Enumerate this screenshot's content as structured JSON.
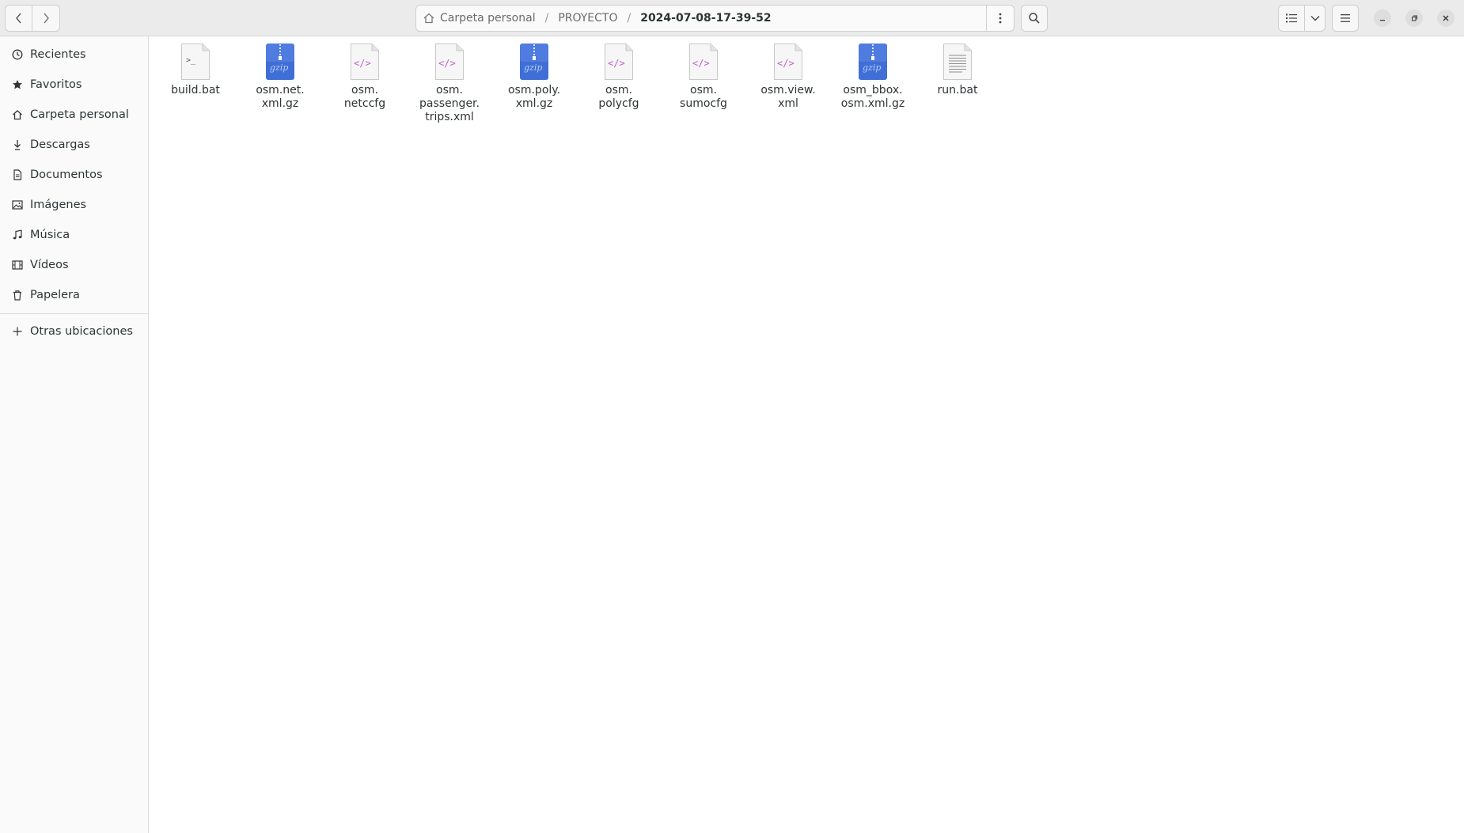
{
  "path": {
    "crumbs": [
      "Carpeta personal",
      "PROYECTO",
      "2024-07-08-17-39-52"
    ]
  },
  "sidebar": {
    "items": [
      {
        "label": "Recientes",
        "icon": "clock-icon"
      },
      {
        "label": "Favoritos",
        "icon": "star-icon"
      },
      {
        "label": "Carpeta personal",
        "icon": "home-icon"
      },
      {
        "label": "Descargas",
        "icon": "download-icon"
      },
      {
        "label": "Documentos",
        "icon": "document-icon"
      },
      {
        "label": "Imágenes",
        "icon": "image-icon"
      },
      {
        "label": "Música",
        "icon": "music-icon"
      },
      {
        "label": "Vídeos",
        "icon": "video-icon"
      },
      {
        "label": "Papelera",
        "icon": "trash-icon"
      }
    ],
    "other_locations": "Otras ubicaciones"
  },
  "files": [
    {
      "name": "build.bat",
      "type": "script"
    },
    {
      "name": "osm.net.\nxml.gz",
      "type": "gzip"
    },
    {
      "name": "osm.\nnetccfg",
      "type": "xml"
    },
    {
      "name": "osm.\npassenger.\ntrips.xml",
      "type": "xml"
    },
    {
      "name": "osm.poly.\nxml.gz",
      "type": "gzip"
    },
    {
      "name": "osm.\npolycfg",
      "type": "xml"
    },
    {
      "name": "osm.\nsumocfg",
      "type": "xml"
    },
    {
      "name": "osm.view.\nxml",
      "type": "xml"
    },
    {
      "name": "osm_bbox.\nosm.xml.gz",
      "type": "gzip"
    },
    {
      "name": "run.bat",
      "type": "text"
    }
  ],
  "colors": {
    "gzip": "#3f6fd6",
    "xml_tag": "#c061cb",
    "titlebar": "#ebebeb"
  }
}
